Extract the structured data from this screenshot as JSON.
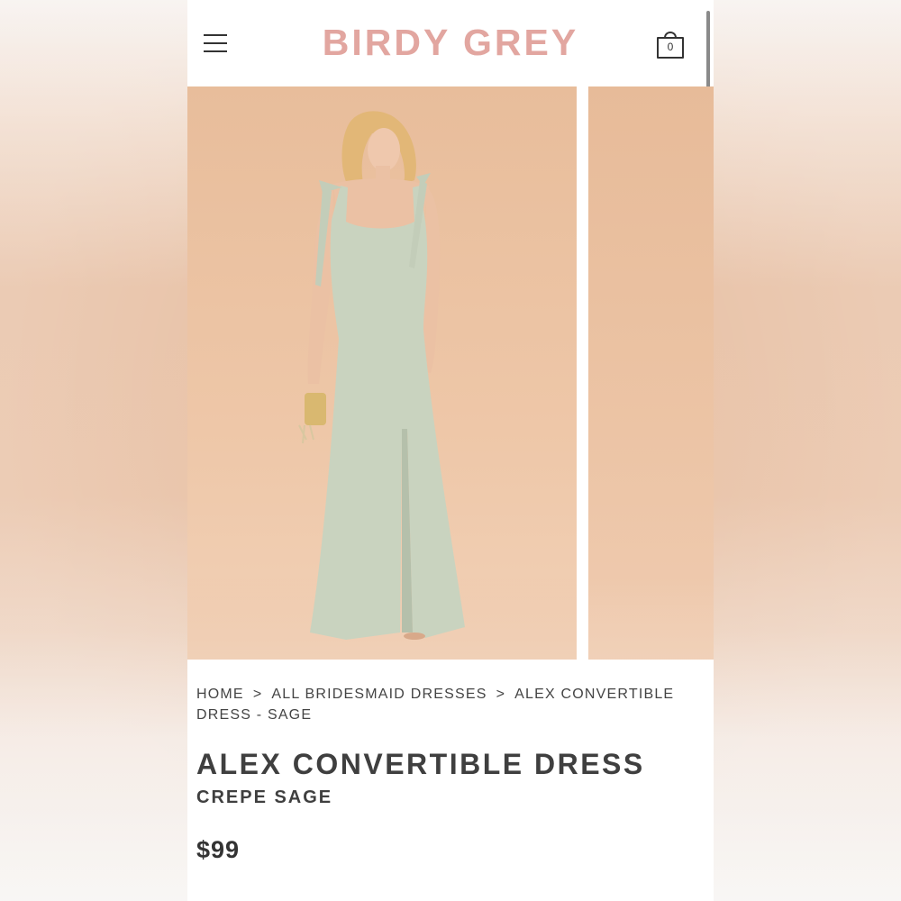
{
  "header": {
    "brand": "BIRDY GREY",
    "cart_count": "0"
  },
  "breadcrumb": {
    "items": [
      "HOME",
      "ALL BRIDESMAID DRESSES",
      "ALEX CONVERTIBLE DRESS - SAGE"
    ],
    "separator": ">"
  },
  "product": {
    "name": "ALEX CONVERTIBLE DRESS",
    "variant": "CREPE SAGE",
    "price": "$99"
  },
  "colors": {
    "brand_pink": "#e2a6a0",
    "dress_sage": "#c9d3bf",
    "backdrop_peach": "#e9c1a4"
  },
  "icons": [
    "hamburger-menu-icon",
    "shopping-bag-icon"
  ]
}
